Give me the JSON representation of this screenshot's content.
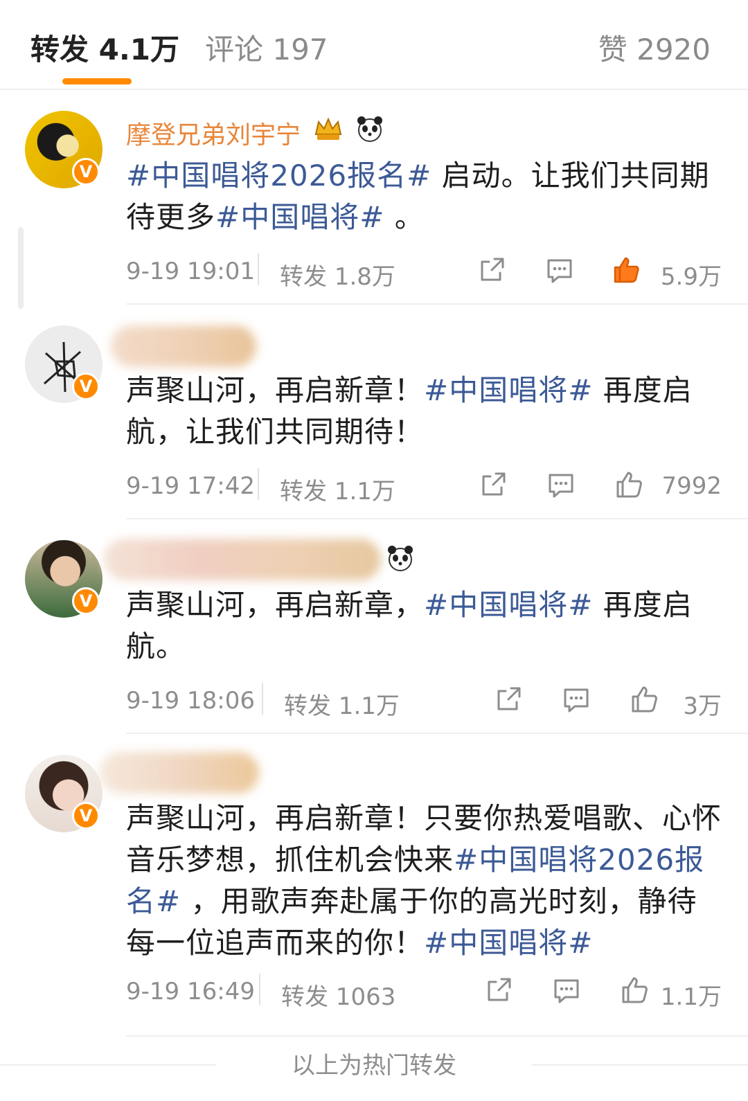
{
  "tabs": {
    "repost": "转发 4.1万",
    "comments": "评论 197",
    "likes": "赞 2920"
  },
  "reposts": [
    {
      "name": "摩登兄弟刘宇宁",
      "verified": "V",
      "text_parts": [
        {
          "t": "#中国唱将2026报名#",
          "tag": true
        },
        {
          "t": " 启动。让我们共同期待更多",
          "tag": false
        },
        {
          "t": "#中国唱将#",
          "tag": true
        },
        {
          "t": " 。",
          "tag": false
        }
      ],
      "time": "9-19 19:01",
      "repost": "转发 1.8万",
      "likes": "5.9万",
      "liked": true
    },
    {
      "name": "",
      "verified": "V",
      "text_parts": [
        {
          "t": "声聚山河，再启新章！",
          "tag": false
        },
        {
          "t": "#中国唱将#",
          "tag": true
        },
        {
          "t": " 再度启航，让我们共同期待！",
          "tag": false
        }
      ],
      "time": "9-19 17:42",
      "repost": "转发 1.1万",
      "likes": "7992",
      "liked": false
    },
    {
      "name": "",
      "verified": "V",
      "text_parts": [
        {
          "t": "声聚山河，再启新章，",
          "tag": false
        },
        {
          "t": "#中国唱将#",
          "tag": true
        },
        {
          "t": " 再度启航。",
          "tag": false
        }
      ],
      "time": "9-19 18:06",
      "repost": "转发 1.1万",
      "likes": "3万",
      "liked": false
    },
    {
      "name": "",
      "verified": "V",
      "text_parts": [
        {
          "t": "声聚山河，再启新章！只要你热爱唱歌、心怀音乐梦想，抓住机会快来",
          "tag": false
        },
        {
          "t": "#中国唱将2026报名#",
          "tag": true
        },
        {
          "t": " ，用歌声奔赴属于你的高光时刻，静待每一位追声而来的你！",
          "tag": false
        },
        {
          "t": "#中国唱将#",
          "tag": true
        }
      ],
      "time": "9-19 16:49",
      "repost": "转发 1063",
      "likes": "1.1万",
      "liked": false
    }
  ],
  "icons": {
    "share": "share-icon",
    "comment": "comment-icon",
    "like": "thumbs-up-icon",
    "crown_badge": "crown-badge-icon",
    "panda_badge": "panda-badge-icon"
  },
  "colors": {
    "accent": "#ff8a00",
    "name": "#e8863a",
    "hashtag": "#3c5a96",
    "meta": "#8d8d8d"
  },
  "footer": {
    "label": "以上为热门转发"
  }
}
